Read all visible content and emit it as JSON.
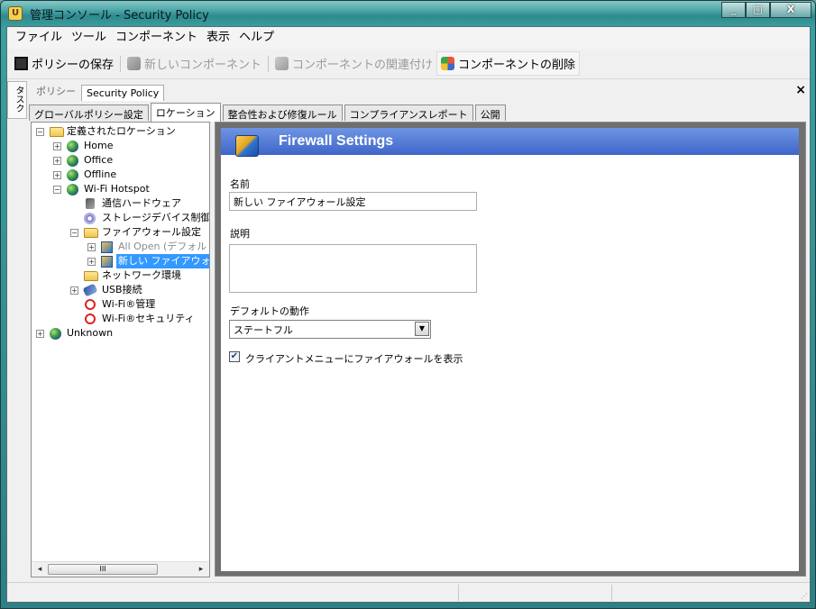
{
  "window": {
    "title": "管理コンソール - Security Policy",
    "controls": [
      "_",
      "□",
      "X"
    ]
  },
  "menu": [
    "ファイル",
    "ツール",
    "コンポーネント",
    "表示",
    "ヘルプ"
  ],
  "toolbar": {
    "save_label": "ポリシーの保存",
    "new_component_label": "新しいコンポーネント",
    "associate_label": "コンポーネントの関連付け",
    "delete_label": "コンポーネントの削除"
  },
  "sidetab": "タスク",
  "doc": {
    "label": "ポリシー",
    "tab": "Security Policy",
    "close": "×"
  },
  "tabs": [
    "グローバルポリシー設定",
    "ロケーション",
    "整合性および修復ルール",
    "コンプライアンスレポート",
    "公開"
  ],
  "tree": {
    "root": "定義されたロケーション",
    "home": "Home",
    "office": "Office",
    "offline": "Offline",
    "wifi_hotspot": "Wi-Fi Hotspot",
    "comm_hw": "通信ハードウェア",
    "storage": "ストレージデバイス制御",
    "firewall_settings": "ファイアウォール設定",
    "all_open": "All Open (デフォルト",
    "new_firewall": "新しい ファイアウォー",
    "network_env": "ネットワーク環境",
    "usb": "USB接続",
    "wifi_manage": "Wi-Fi®管理",
    "wifi_security": "Wi-Fi®セキュリティ",
    "unknown": "Unknown"
  },
  "scrollbar": {
    "thumb": "III",
    "left": "◂",
    "right": "▸"
  },
  "panel": {
    "title": "Firewall Settings",
    "name_label": "名前",
    "name_value": "新しい ファイアウォール設定",
    "desc_label": "説明",
    "desc_value": "",
    "default_action_label": "デフォルトの動作",
    "default_action_value": "ステートフル",
    "show_in_client_label": "クライアントメニューにファイアウォールを表示",
    "show_in_client_checked": true
  },
  "colors": {
    "header_band": "#4a72d2",
    "selection": "#3399ff",
    "title_bar": "#3c9c9c"
  }
}
